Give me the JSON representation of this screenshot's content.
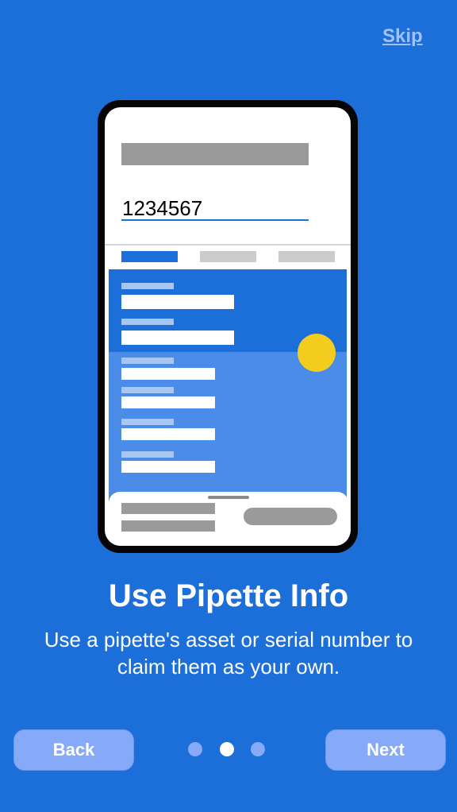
{
  "header": {
    "skip_label": "Skip"
  },
  "illustration": {
    "serial_value": "1234567",
    "colors": {
      "accent": "#1c6fd8",
      "fab": "#f3cc1e"
    }
  },
  "content": {
    "title": "Use Pipette Info",
    "description": "Use a pipette's asset or serial number to claim them as your own."
  },
  "footer": {
    "back_label": "Back",
    "next_label": "Next",
    "pager": {
      "total": 3,
      "active_index": 2
    }
  },
  "theme": {
    "background": "#1c6fd8",
    "button": "#86aaf8"
  }
}
